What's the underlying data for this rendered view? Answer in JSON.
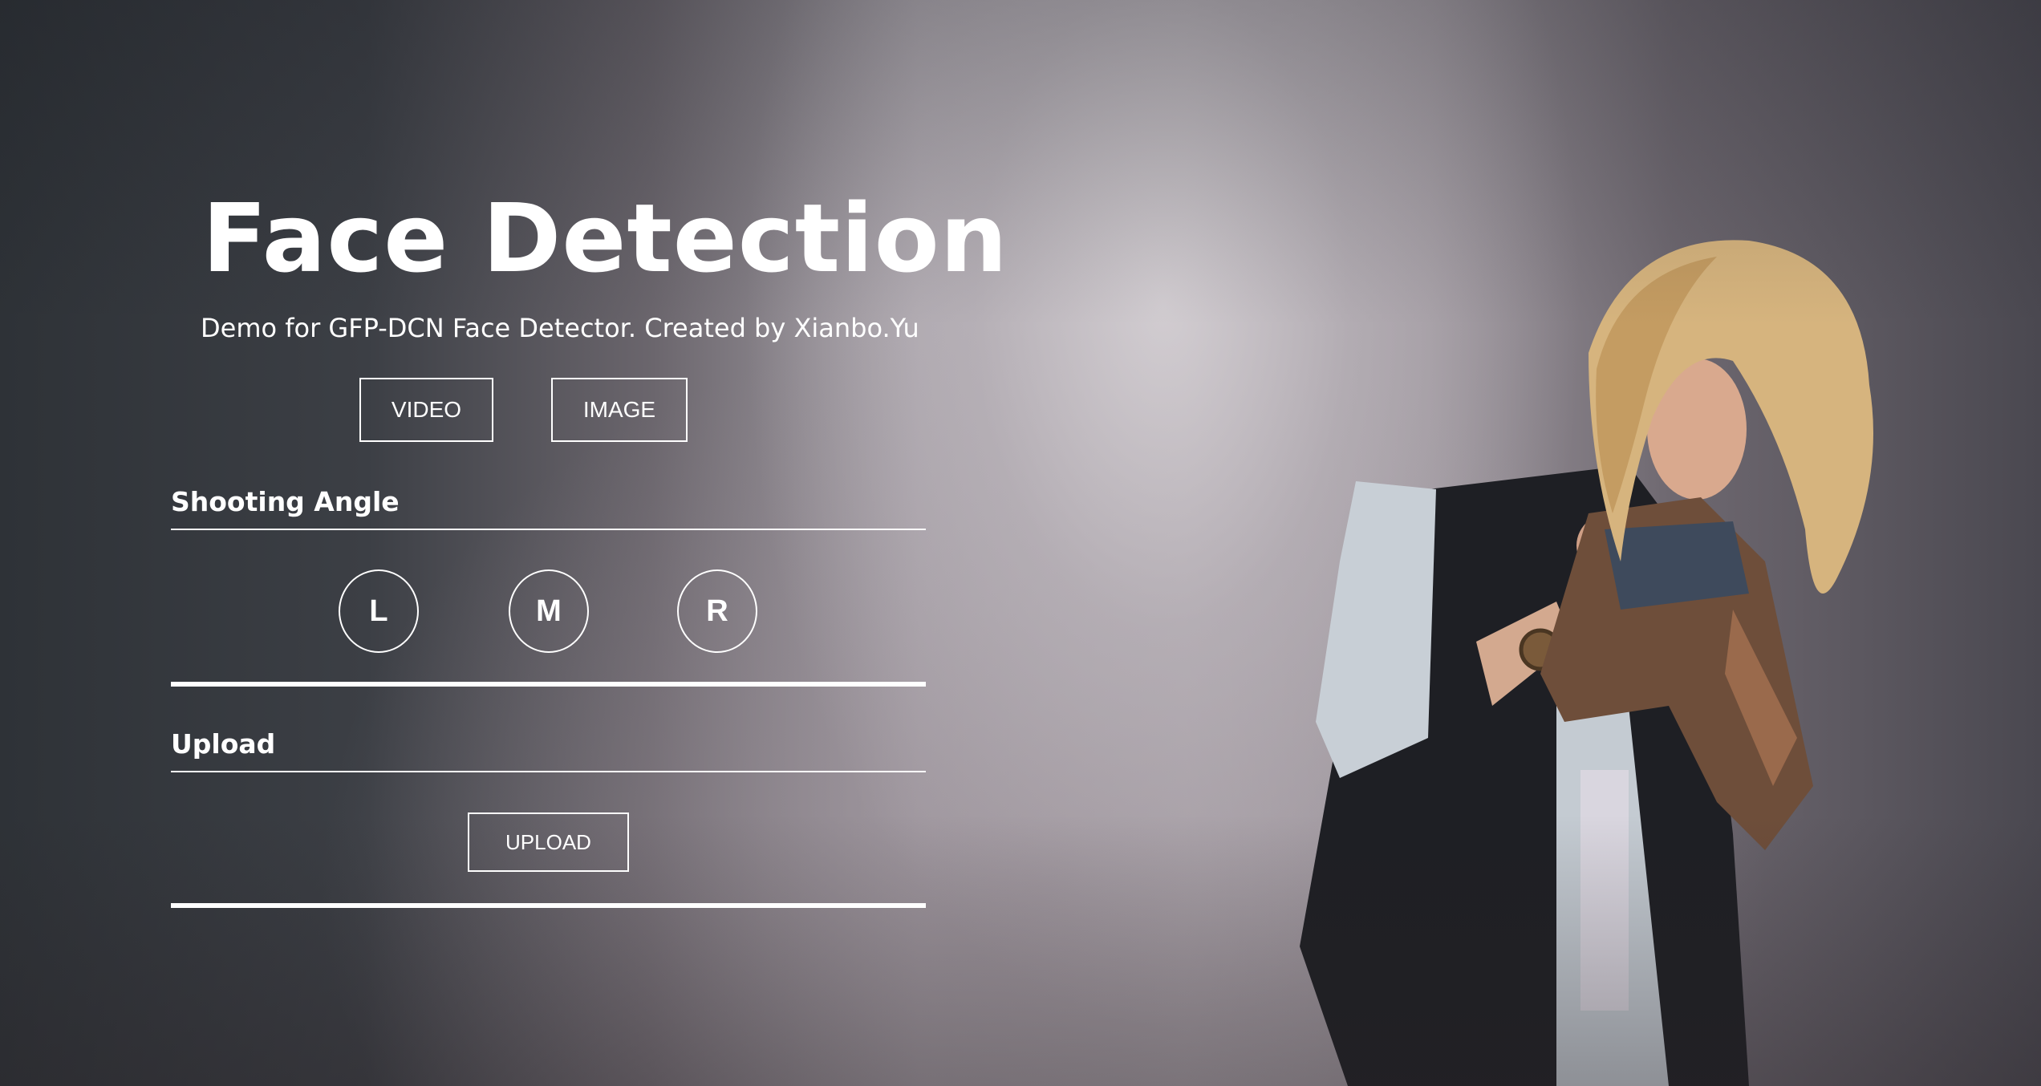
{
  "header": {
    "title": "Face Detection",
    "subtitle": "Demo for GFP-DCN Face Detector. Created by Xianbo.Yu"
  },
  "modes": {
    "video_label": "VIDEO",
    "image_label": "IMAGE"
  },
  "shooting_angle": {
    "label": "Shooting Angle",
    "options": [
      "L",
      "M",
      "R"
    ]
  },
  "upload": {
    "label": "Upload",
    "button_label": "UPLOAD"
  },
  "colors": {
    "text": "#ffffff",
    "border": "#ffffff"
  }
}
